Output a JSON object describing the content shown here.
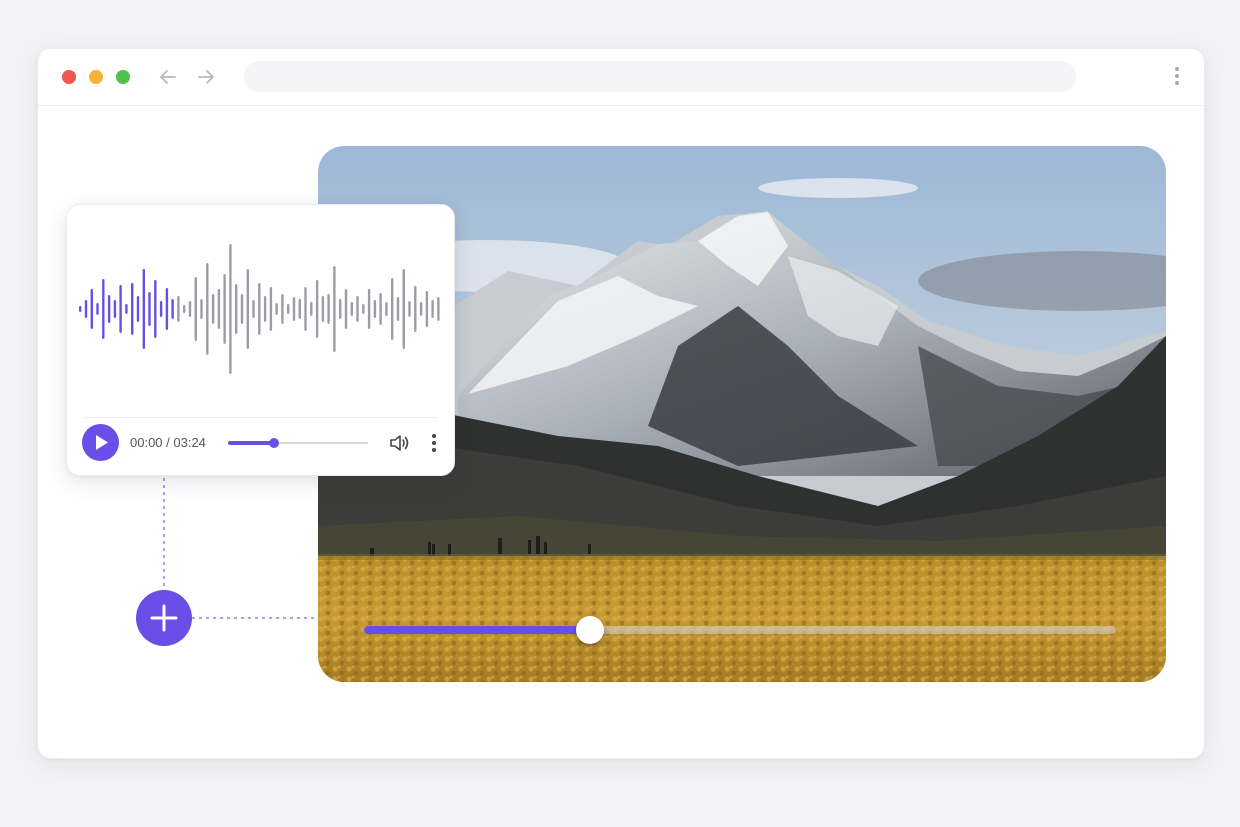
{
  "window": {
    "traffic_lights": [
      "#f0564f",
      "#f5b33b",
      "#4fc14d"
    ],
    "nav": {
      "back_icon": "arrow-left-icon",
      "forward_icon": "arrow-right-icon"
    },
    "address_bar": {
      "value": ""
    },
    "menu_icon": "vertical-ellipsis-icon"
  },
  "audio_card": {
    "time_display": "00:00 / 03:24",
    "progress": 0.33,
    "played_waveform_fraction": 0.27,
    "colors": {
      "accent": "#6a4ee8",
      "played_wave": "#6a4ee8",
      "unplayed_wave": "#9c9ca6"
    },
    "icons": {
      "play": "play-icon",
      "volume": "volume-icon",
      "more": "vertical-ellipsis-icon"
    }
  },
  "video": {
    "image": "mountain-landscape-photo",
    "progress": 0.3,
    "colors": {
      "fill": "#6a4ee8",
      "knob": "#ffffff"
    }
  },
  "add_button": {
    "icon": "plus-icon"
  }
}
